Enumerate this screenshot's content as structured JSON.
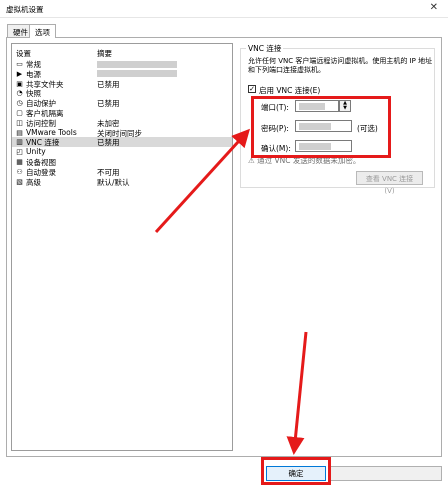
{
  "window": {
    "title": "虚拟机设置",
    "close_glyph": "✕"
  },
  "tabs": [
    {
      "label": "硬件"
    },
    {
      "label": "选项"
    }
  ],
  "settings_list": {
    "header_setting": "设置",
    "header_summary": "摘要",
    "items": [
      {
        "name": "常规",
        "summary": "",
        "icon": "general-icon",
        "glyph": "▭"
      },
      {
        "name": "电源",
        "summary": "",
        "icon": "power-icon",
        "glyph": "▶"
      },
      {
        "name": "共享文件夹",
        "summary": "已禁用",
        "icon": "shared-folders-icon",
        "glyph": "▣"
      },
      {
        "name": "快照",
        "summary": "",
        "icon": "snapshot-icon",
        "glyph": "◔"
      },
      {
        "name": "自动保护",
        "summary": "已禁用",
        "icon": "autoprotect-icon",
        "glyph": "◷"
      },
      {
        "name": "客户机隔离",
        "summary": "",
        "icon": "isolation-icon",
        "glyph": "▢"
      },
      {
        "name": "访问控制",
        "summary": "未加密",
        "icon": "access-control-icon",
        "glyph": "◫"
      },
      {
        "name": "VMware Tools",
        "summary": "关闭时间同步",
        "icon": "vmware-tools-icon",
        "glyph": "▤"
      },
      {
        "name": "VNC 连接",
        "summary": "已禁用",
        "icon": "vnc-icon",
        "glyph": "▥"
      },
      {
        "name": "Unity",
        "summary": "",
        "icon": "unity-icon",
        "glyph": "◰"
      },
      {
        "name": "设备视图",
        "summary": "",
        "icon": "device-view-icon",
        "glyph": "▦"
      },
      {
        "name": "自动登录",
        "summary": "不可用",
        "icon": "autologin-icon",
        "glyph": "⚇"
      },
      {
        "name": "高级",
        "summary": "默认/默认",
        "icon": "advanced-icon",
        "glyph": "▧"
      }
    ]
  },
  "vnc": {
    "group_title": "VNC 连接",
    "description": "允许任何 VNC 客户端远程访问虚拟机。使用主机的 IP 地址和下列端口连接虚拟机。",
    "enable_label": "启用 VNC 连接(E)",
    "enable_mark": "✓",
    "port_label": "端口(T):",
    "password_label": "密码(P):",
    "password_optional": "(可选)",
    "confirm_label": "确认(M):",
    "warning_icon": "⚠",
    "warning": "通过 VNC 发送的数据未加密。",
    "view_button": "查看 VNC 连接(V)",
    "spin_up": "▲",
    "spin_down": "▼"
  },
  "footer": {
    "ok_label": "确定"
  },
  "colors": {
    "highlight_red": "#e51a1a",
    "selection": "#d9d9d9",
    "accent": "#0078d7"
  }
}
